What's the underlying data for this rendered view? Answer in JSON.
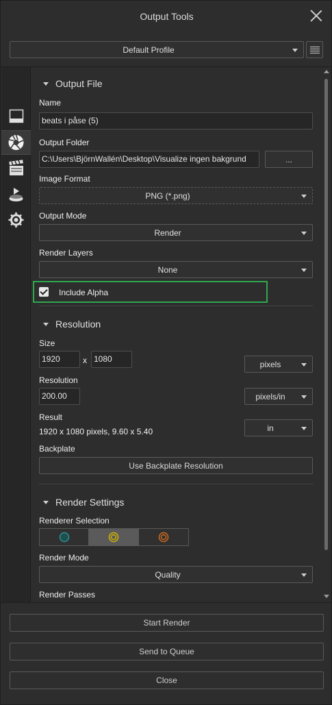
{
  "window": {
    "title": "Output Tools"
  },
  "profile": {
    "selected": "Default Profile"
  },
  "output_file": {
    "heading": "Output File",
    "name_label": "Name",
    "name_value": "beats i påse (5)",
    "folder_label": "Output Folder",
    "folder_value": "C:\\Users\\BjörnWallén\\Desktop\\Visualize ingen bakgrund",
    "browse_label": "...",
    "format_label": "Image Format",
    "format_value": "PNG (*.png)",
    "mode_label": "Output Mode",
    "mode_value": "Render",
    "layers_label": "Render Layers",
    "layers_value": "None",
    "alpha_label": "Include Alpha",
    "alpha_checked": true
  },
  "resolution": {
    "heading": "Resolution",
    "size_label": "Size",
    "width": "1920",
    "x_sep": "x",
    "height": "1080",
    "size_unit": "pixels",
    "res_label": "Resolution",
    "res_value": "200.00",
    "res_unit": "pixels/in",
    "result_label": "Result",
    "result_value": "1920 x 1080 pixels, 9.60 x 5.40",
    "result_unit": "in",
    "backplate_label": "Backplate",
    "backplate_button": "Use Backplate Resolution"
  },
  "render_settings": {
    "heading": "Render Settings",
    "renderer_label": "Renderer Selection",
    "renderers": [
      {
        "icon": "cpu-renderer-icon",
        "color": "#2f8f8f"
      },
      {
        "icon": "hybrid-renderer-icon",
        "color": "#d4b400",
        "selected": true
      },
      {
        "icon": "gpu-renderer-icon",
        "color": "#d06a1e"
      }
    ],
    "mode_label": "Render Mode",
    "mode_value": "Quality",
    "passes_label": "Render Passes"
  },
  "footer": {
    "start_render": "Start Render",
    "send_to_queue": "Send to Queue",
    "close": "Close"
  },
  "colors": {
    "highlight": "#2fa84f",
    "background": "#2d2d2d"
  }
}
